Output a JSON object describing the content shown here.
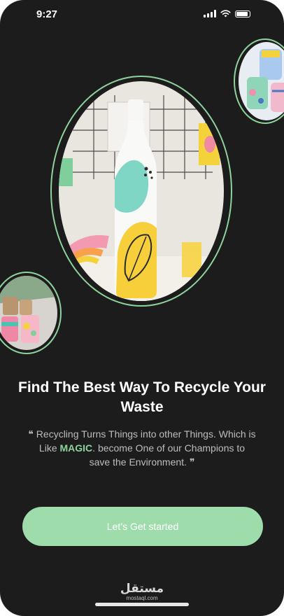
{
  "status_bar": {
    "time": "9:27"
  },
  "onboarding": {
    "title": "Find The Best Way To Recycle Your Waste",
    "quote_open": "❝",
    "quote_before": " Recycling Turns Things into other Things. Which is Like ",
    "quote_highlight": "MAGIC",
    "quote_after": ". become One of our Champions to save the Environment. ",
    "quote_close": "❞",
    "cta_label": "Let’s Get started"
  },
  "watermark": {
    "logo": "مستقل",
    "url": "mostaql.com"
  },
  "colors": {
    "background": "#1c1c1c",
    "accent": "#8ed39c",
    "button": "#9fdcab"
  },
  "images": [
    {
      "name": "painted-bottle-photo"
    },
    {
      "name": "painted-jars-photo"
    },
    {
      "name": "painted-cans-photo"
    }
  ]
}
